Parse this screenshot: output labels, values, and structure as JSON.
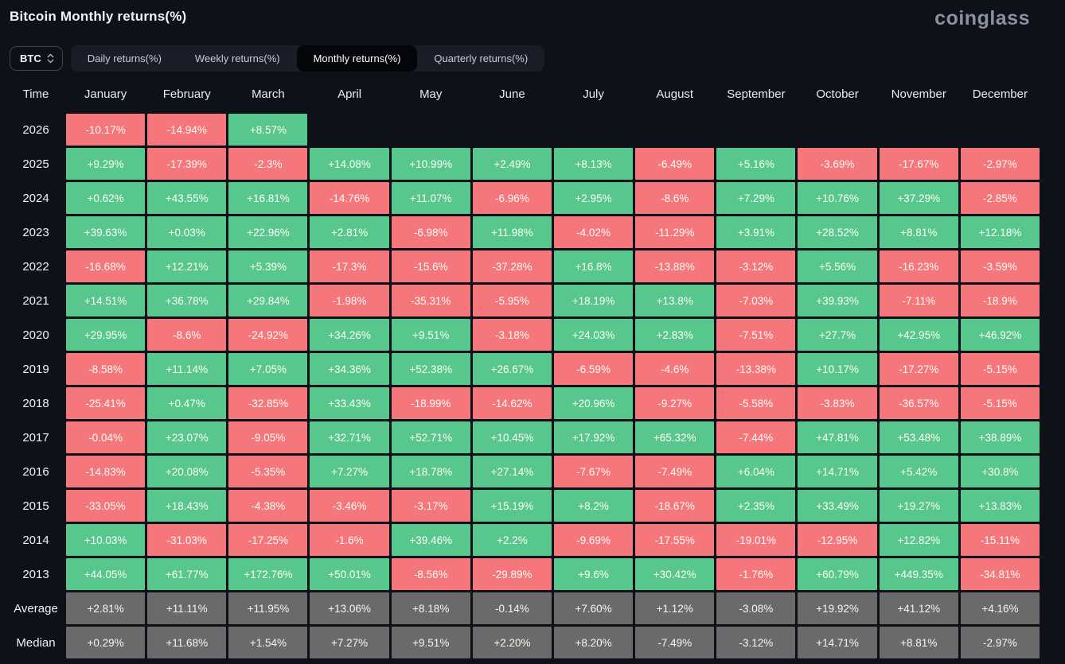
{
  "page": {
    "title": "Bitcoin Monthly returns(%)",
    "logo_text": "coinglass"
  },
  "controls": {
    "symbol": "BTC",
    "tabs": [
      {
        "label": "Daily returns(%)",
        "active": false
      },
      {
        "label": "Weekly returns(%)",
        "active": false
      },
      {
        "label": "Monthly returns(%)",
        "active": true
      },
      {
        "label": "Quarterly returns(%)",
        "active": false
      }
    ]
  },
  "colors": {
    "positive": "#58c78d",
    "negative": "#f5777c",
    "summary": "#6a6a6a"
  },
  "table": {
    "columns": [
      "Time",
      "January",
      "February",
      "March",
      "April",
      "May",
      "June",
      "July",
      "August",
      "September",
      "October",
      "November",
      "December"
    ],
    "rows": [
      {
        "time": "2026",
        "kind": "year",
        "values": [
          "-10.17%",
          "-14.94%",
          "+8.57%",
          null,
          null,
          null,
          null,
          null,
          null,
          null,
          null,
          null
        ]
      },
      {
        "time": "2025",
        "kind": "year",
        "values": [
          "+9.29%",
          "-17.39%",
          "-2.3%",
          "+14.08%",
          "+10.99%",
          "+2.49%",
          "+8.13%",
          "-6.49%",
          "+5.16%",
          "-3.69%",
          "-17.67%",
          "-2.97%"
        ]
      },
      {
        "time": "2024",
        "kind": "year",
        "values": [
          "+0.62%",
          "+43.55%",
          "+16.81%",
          "-14.76%",
          "+11.07%",
          "-6.96%",
          "+2.95%",
          "-8.6%",
          "+7.29%",
          "+10.76%",
          "+37.29%",
          "-2.85%"
        ]
      },
      {
        "time": "2023",
        "kind": "year",
        "values": [
          "+39.63%",
          "+0.03%",
          "+22.96%",
          "+2.81%",
          "-6.98%",
          "+11.98%",
          "-4.02%",
          "-11.29%",
          "+3.91%",
          "+28.52%",
          "+8.81%",
          "+12.18%"
        ]
      },
      {
        "time": "2022",
        "kind": "year",
        "values": [
          "-16.68%",
          "+12.21%",
          "+5.39%",
          "-17.3%",
          "-15.6%",
          "-37.28%",
          "+16.8%",
          "-13.88%",
          "-3.12%",
          "+5.56%",
          "-16.23%",
          "-3.59%"
        ]
      },
      {
        "time": "2021",
        "kind": "year",
        "values": [
          "+14.51%",
          "+36.78%",
          "+29.84%",
          "-1.98%",
          "-35.31%",
          "-5.95%",
          "+18.19%",
          "+13.8%",
          "-7.03%",
          "+39.93%",
          "-7.11%",
          "-18.9%"
        ]
      },
      {
        "time": "2020",
        "kind": "year",
        "values": [
          "+29.95%",
          "-8.6%",
          "-24.92%",
          "+34.26%",
          "+9.51%",
          "-3.18%",
          "+24.03%",
          "+2.83%",
          "-7.51%",
          "+27.7%",
          "+42.95%",
          "+46.92%"
        ]
      },
      {
        "time": "2019",
        "kind": "year",
        "values": [
          "-8.58%",
          "+11.14%",
          "+7.05%",
          "+34.36%",
          "+52.38%",
          "+26.67%",
          "-6.59%",
          "-4.6%",
          "-13.38%",
          "+10.17%",
          "-17.27%",
          "-5.15%"
        ]
      },
      {
        "time": "2018",
        "kind": "year",
        "values": [
          "-25.41%",
          "+0.47%",
          "-32.85%",
          "+33.43%",
          "-18.99%",
          "-14.62%",
          "+20.96%",
          "-9.27%",
          "-5.58%",
          "-3.83%",
          "-36.57%",
          "-5.15%"
        ]
      },
      {
        "time": "2017",
        "kind": "year",
        "values": [
          "-0.04%",
          "+23.07%",
          "-9.05%",
          "+32.71%",
          "+52.71%",
          "+10.45%",
          "+17.92%",
          "+65.32%",
          "-7.44%",
          "+47.81%",
          "+53.48%",
          "+38.89%"
        ]
      },
      {
        "time": "2016",
        "kind": "year",
        "values": [
          "-14.83%",
          "+20.08%",
          "-5.35%",
          "+7.27%",
          "+18.78%",
          "+27.14%",
          "-7.67%",
          "-7.49%",
          "+6.04%",
          "+14.71%",
          "+5.42%",
          "+30.8%"
        ]
      },
      {
        "time": "2015",
        "kind": "year",
        "values": [
          "-33.05%",
          "+18.43%",
          "-4.38%",
          "-3.46%",
          "-3.17%",
          "+15.19%",
          "+8.2%",
          "-18.67%",
          "+2.35%",
          "+33.49%",
          "+19.27%",
          "+13.83%"
        ]
      },
      {
        "time": "2014",
        "kind": "year",
        "values": [
          "+10.03%",
          "-31.03%",
          "-17.25%",
          "-1.6%",
          "+39.46%",
          "+2.2%",
          "-9.69%",
          "-17.55%",
          "-19.01%",
          "-12.95%",
          "+12.82%",
          "-15.11%"
        ]
      },
      {
        "time": "2013",
        "kind": "year",
        "values": [
          "+44.05%",
          "+61.77%",
          "+172.76%",
          "+50.01%",
          "-8.56%",
          "-29.89%",
          "+9.6%",
          "+30.42%",
          "-1.76%",
          "+60.79%",
          "+449.35%",
          "-34.81%"
        ]
      },
      {
        "time": "Average",
        "kind": "summary",
        "values": [
          "+2.81%",
          "+11.11%",
          "+11.95%",
          "+13.06%",
          "+8.18%",
          "-0.14%",
          "+7.60%",
          "+1.12%",
          "-3.08%",
          "+19.92%",
          "+41.12%",
          "+4.16%"
        ]
      },
      {
        "time": "Median",
        "kind": "summary",
        "values": [
          "+0.29%",
          "+11.68%",
          "+1.54%",
          "+7.27%",
          "+9.51%",
          "+2.20%",
          "+8.20%",
          "-7.49%",
          "-3.12%",
          "+14.71%",
          "+8.81%",
          "-2.97%"
        ]
      }
    ]
  }
}
